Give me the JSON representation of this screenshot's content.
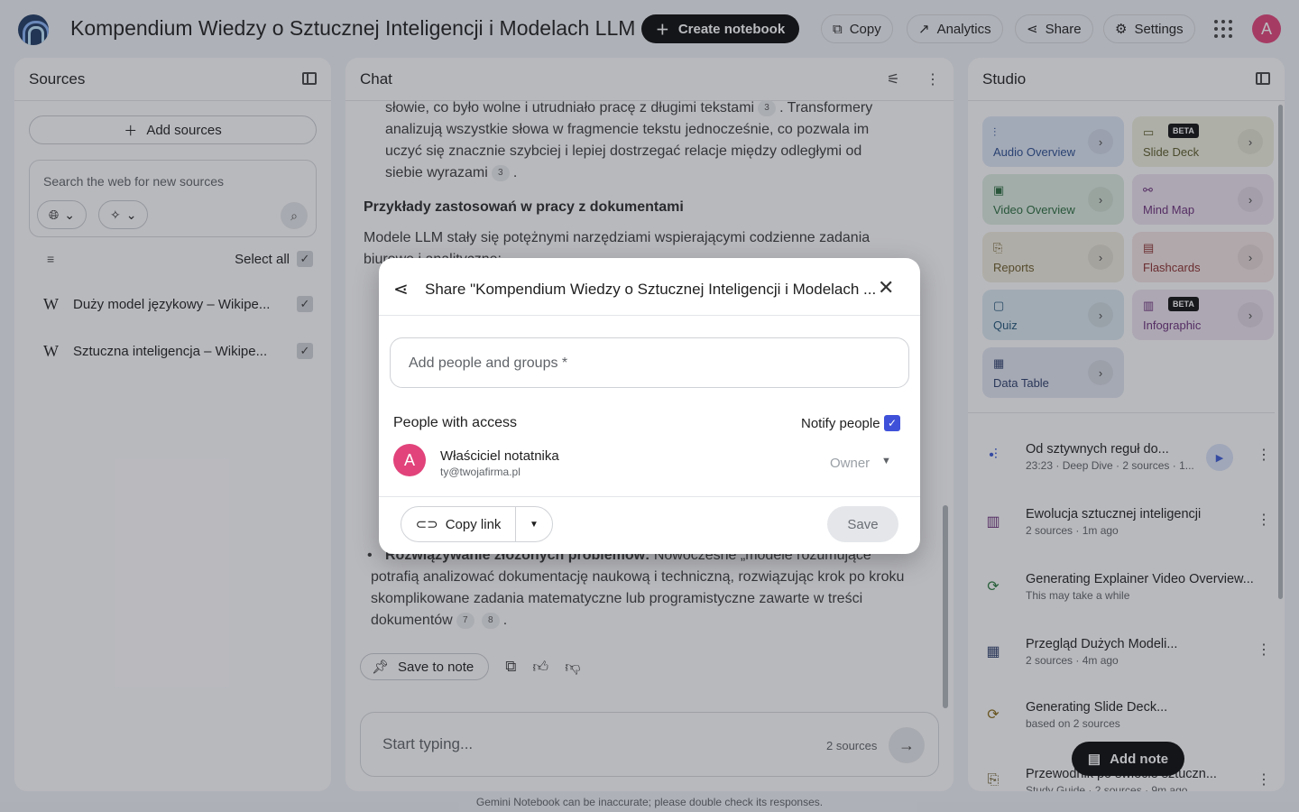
{
  "app": {
    "title": "Kompendium Wiedzy o Sztucznej Inteligencji i Modelach LLM",
    "logo_icon": "notebook-logo-icon"
  },
  "toolbar": {
    "create_label": "Create notebook",
    "copy_label": "Copy",
    "analytics_label": "Analytics",
    "share_label": "Share",
    "settings_label": "Settings",
    "avatar_letter": "A"
  },
  "sources": {
    "title": "Sources",
    "add_label": "Add sources",
    "search_placeholder": "Search the web for new sources",
    "select_all_label": "Select all",
    "items": [
      {
        "label": "Duży model językowy – Wikipe...",
        "icon": "wikipedia-icon",
        "checked": true
      },
      {
        "label": "Sztuczna inteligencja – Wikipe...",
        "icon": "wikipedia-icon",
        "checked": true
      }
    ]
  },
  "chat": {
    "title": "Chat",
    "para1_a": "słowie, co było wolne i utrudniało pracę z długimi tekstami",
    "para1_cite1": "3",
    "para1_b": ". Transformery analizują wszystkie słowa w fragmencie tekstu jednocześnie, co pozwala im uczyć się znacznie szybciej i lepiej dostrzegać relacje między odległymi od siebie wyrazami",
    "para1_cite2": "3",
    "para1_c": ".",
    "heading": "Przykłady zastosowań w pracy z dokumentami",
    "para2": "Modele LLM stały się potężnymi narzędziami wspierającymi codzienne zadania biurowe i analityczne:",
    "bullet_last_bold": "Rozwiązywanie złożonych problemów:",
    "bullet_last_text": "Nowoczesne „modele rozumujące” potrafią analizować dokumentację naukową i techniczną, rozwiązując krok po kroku skomplikowane zadania matematyczne lub programistyczne zawarte w treści dokumentów",
    "bullet_last_cite1": "7",
    "bullet_last_cite2": "8",
    "save_note_label": "Save to note",
    "composer_placeholder": "Start typing...",
    "composer_sources": "2 sources"
  },
  "studio": {
    "title": "Studio",
    "beta_label": "BETA",
    "tiles": [
      {
        "label": "Audio Overview",
        "icon": "audio-waveform-icon",
        "color": "#dde6f5",
        "text_color": "#2b4d8f"
      },
      {
        "label": "Slide Deck",
        "icon": "slides-icon",
        "color": "#eeeedd",
        "text_color": "#5b5a2a"
      },
      {
        "label": "Video Overview",
        "icon": "video-icon",
        "color": "#dcebe0",
        "text_color": "#2a6a3e"
      },
      {
        "label": "Mind Map",
        "icon": "mindmap-icon",
        "color": "#ece2ef",
        "text_color": "#6a2f7a"
      },
      {
        "label": "Reports",
        "icon": "reports-icon",
        "color": "#efeade",
        "text_color": "#6a5a2a"
      },
      {
        "label": "Flashcards",
        "icon": "flashcards-icon",
        "color": "#f2e4e4",
        "text_color": "#8a2e2e"
      },
      {
        "label": "Quiz",
        "icon": "quiz-icon",
        "color": "#dbe8f0",
        "text_color": "#22557a"
      },
      {
        "label": "Infographic",
        "icon": "infographic-icon",
        "color": "#ece2ef",
        "text_color": "#6a2f7a"
      },
      {
        "label": "Data Table",
        "icon": "table-icon",
        "color": "#e1e5f0",
        "text_color": "#2c3d6a"
      }
    ],
    "notes": [
      {
        "title": "Od sztywnych reguł do...",
        "sub": "23:23 · Deep Dive · 2 sources · 1...",
        "icon": "audio-waveform-icon"
      },
      {
        "title": "Ewolucja sztucznej inteligencji",
        "sub": "2 sources · 1m ago",
        "icon": "infographic-icon"
      },
      {
        "title": "Generating Explainer Video Overview...",
        "sub": "This may take a while",
        "icon": "sync-icon"
      },
      {
        "title": "Przegląd Dużych Modeli...",
        "sub": "2 sources · 4m ago",
        "icon": "table-icon"
      },
      {
        "title": "Generating Slide Deck...",
        "sub": "based on 2 sources",
        "icon": "sync-icon"
      },
      {
        "title": "Przewodnik po świecie sztuczn...",
        "sub": "Study Guide · 2 sources · 9m ago",
        "icon": "reports-icon"
      }
    ],
    "add_note_label": "Add note"
  },
  "footer": "Gemini Notebook can be inaccurate; please double check its responses.",
  "share_dialog": {
    "title": "Share \"Kompendium Wiedzy o Sztucznej Inteligencji i Modelach ...",
    "input_placeholder": "Add people and groups *",
    "access_label": "People with access",
    "notify_label": "Notify people",
    "notify_checked": true,
    "person": {
      "avatar": "A",
      "name": "Właściciel notatnika",
      "email": "ty@twojafirma.pl",
      "role": "Owner"
    },
    "copy_link_label": "Copy link",
    "save_label": "Save"
  }
}
